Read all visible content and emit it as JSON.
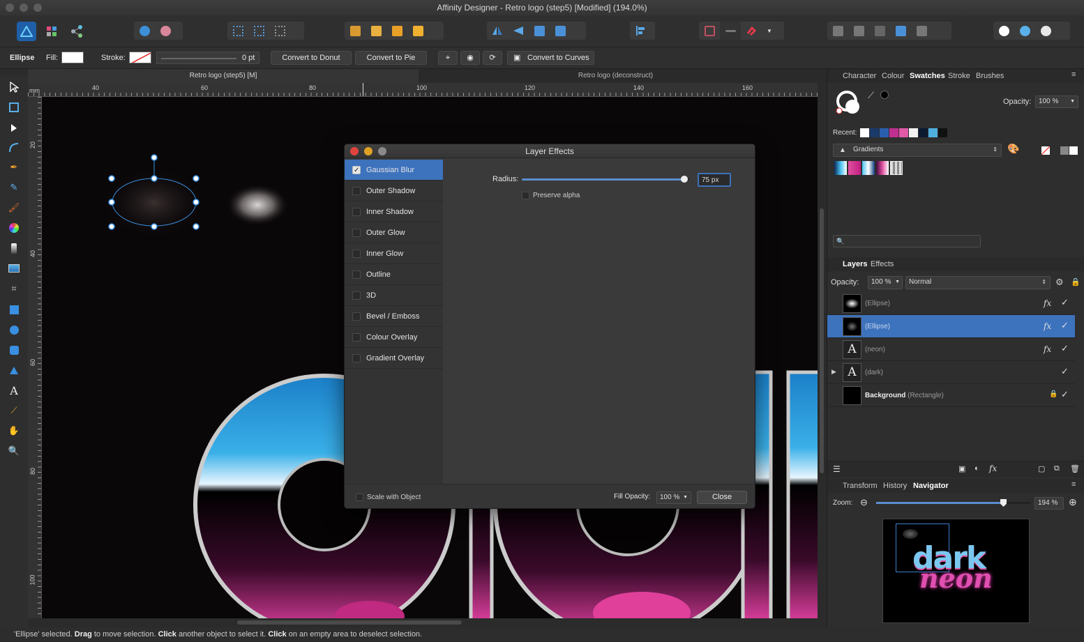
{
  "window": {
    "title": "Affinity Designer - Retro logo (step5) [Modified] (194.0%)"
  },
  "context": {
    "tool": "Ellipse",
    "fill_label": "Fill:",
    "stroke_label": "Stroke:",
    "stroke_width": "0 pt",
    "convert_donut": "Convert to Donut",
    "convert_pie": "Convert to Pie",
    "convert_curves": "Convert to Curves"
  },
  "doc_tabs": [
    "Retro logo (step5) [M]",
    "Retro logo (deconstruct)"
  ],
  "ruler": {
    "top": [
      "40",
      "60",
      "80",
      "100",
      "120",
      "140",
      "160"
    ],
    "left": [
      "20",
      "40",
      "60",
      "80",
      "100"
    ],
    "unit": "mm"
  },
  "dialog": {
    "title": "Layer Effects",
    "effects": [
      {
        "label": "Gaussian Blur",
        "checked": true
      },
      {
        "label": "Outer Shadow",
        "checked": false
      },
      {
        "label": "Inner Shadow",
        "checked": false
      },
      {
        "label": "Outer Glow",
        "checked": false
      },
      {
        "label": "Inner Glow",
        "checked": false
      },
      {
        "label": "Outline",
        "checked": false
      },
      {
        "label": "3D",
        "checked": false
      },
      {
        "label": "Bevel / Emboss",
        "checked": false
      },
      {
        "label": "Colour Overlay",
        "checked": false
      },
      {
        "label": "Gradient Overlay",
        "checked": false
      }
    ],
    "radius_label": "Radius:",
    "radius_value": "75 px",
    "radius_fraction": 0.97,
    "preserve_alpha": "Preserve alpha",
    "scale_with_object": "Scale with Object",
    "fill_opacity_label": "Fill Opacity:",
    "fill_opacity_value": "100 %",
    "close": "Close"
  },
  "swatches_panel": {
    "tabs": [
      "Character",
      "Colour",
      "Swatches",
      "Stroke",
      "Brushes"
    ],
    "active_tab": "Swatches",
    "opacity_label": "Opacity:",
    "opacity_value": "100 %",
    "recent_label": "Recent:",
    "palette": "Gradients",
    "recent_colors": [
      "#ffffff",
      "#1a3a6a",
      "#2a5fb0",
      "#c03090",
      "#e05aa8",
      "#f2f2f2",
      "#0c1a30",
      "#4fb0e0",
      "#111111"
    ]
  },
  "layers_panel": {
    "tabs": [
      "Layers",
      "Effects"
    ],
    "opacity_label": "Opacity:",
    "opacity_value": "100 %",
    "blend_mode": "Normal",
    "layers": [
      {
        "name": "",
        "type": "(Ellipse)",
        "fx": true,
        "selected": false
      },
      {
        "name": "",
        "type": "(Ellipse)",
        "fx": true,
        "selected": true
      },
      {
        "name": "",
        "type": "(neon)",
        "fx": true,
        "selected": false
      },
      {
        "name": "",
        "type": "(dark)",
        "fx": false,
        "selected": false
      },
      {
        "name": "Background",
        "type": "(Rectangle)",
        "fx": false,
        "selected": false
      }
    ]
  },
  "navigator_panel": {
    "tabs": [
      "Transform",
      "History",
      "Navigator"
    ],
    "active_tab": "Navigator",
    "zoom_label": "Zoom:",
    "zoom_value": "194 %",
    "zoom_fraction": 0.82,
    "preview_text_1": "dark",
    "preview_text_2": "neon"
  },
  "status": {
    "parts": [
      {
        "text": "'Ellipse' selected. ",
        "bold": false
      },
      {
        "text": "Drag",
        "bold": true
      },
      {
        "text": " to move selection. ",
        "bold": false
      },
      {
        "text": "Click",
        "bold": true
      },
      {
        "text": " another object to select it. ",
        "bold": false
      },
      {
        "text": "Click",
        "bold": true
      },
      {
        "text": " on an empty area to deselect selection.",
        "bold": false
      }
    ]
  },
  "colors": {
    "accent": "#3d72bd",
    "canvas": "#0a0708",
    "panel": "#2e2e2e"
  }
}
